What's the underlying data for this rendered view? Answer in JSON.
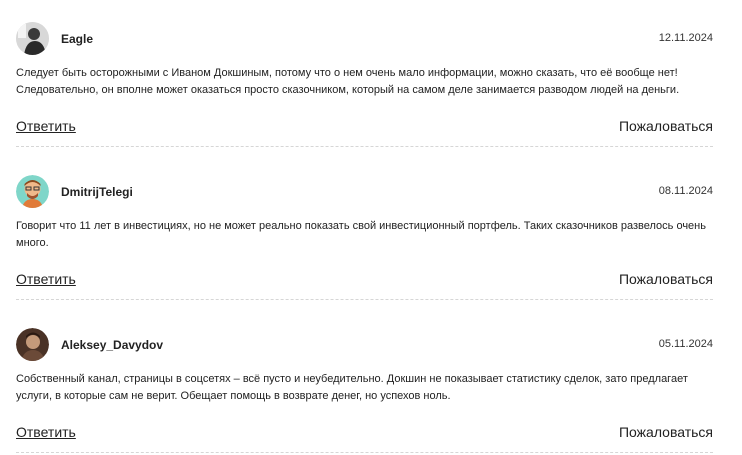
{
  "comments": [
    {
      "author": "Eagle",
      "date": "12.11.2024",
      "text": "Следует быть осторожными с Иваном Докшиным, потому что о нем очень мало информации, можно сказать, что её вообще нет! Следовательно, он вполне может оказаться просто сказочником, который на самом деле занимается разводом людей на деньги.",
      "avatar_icon": "person-photo-avatar"
    },
    {
      "author": "DmitrijTelegi",
      "date": "08.11.2024",
      "text": "Говорит что 11 лет в инвестициях, но не может реально показать свой инвестиционный портфель. Таких сказочников развелось очень много.",
      "avatar_icon": "cartoon-avatar"
    },
    {
      "author": "Aleksey_Davydov",
      "date": "05.11.2024",
      "text": "Собственный канал, страницы в соцсетях – всё пусто и неубедительно. Докшин не показывает статистику сделок, зато предлагает услуги, в которые сам не верит. Обещает помощь в возврате денег, но успехов ноль.",
      "avatar_icon": "person-photo-avatar"
    }
  ],
  "actions": {
    "reply_label": "Ответить",
    "report_label": "Пожаловаться"
  }
}
